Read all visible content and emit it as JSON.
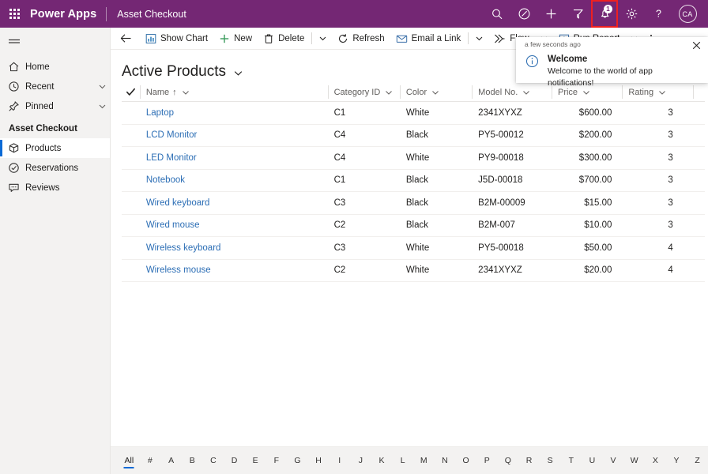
{
  "topbar": {
    "brand": "Power Apps",
    "app_name": "Asset Checkout",
    "waffle_name": "app-launcher",
    "actions": [
      {
        "name": "search-icon",
        "label": "Search"
      },
      {
        "name": "diagnostics-icon",
        "label": "Diagnostics"
      },
      {
        "name": "plus-icon",
        "label": "New"
      },
      {
        "name": "filter-icon",
        "label": "Filter"
      }
    ],
    "notification": {
      "name": "notification-bell-icon",
      "badge": "1",
      "highlight_color": "#ef2020"
    },
    "settings_label": "Settings",
    "help_label": "Help",
    "avatar_initials": "CA",
    "bar_color": "#742774"
  },
  "sidebar": {
    "hamburger_label": "Expand / collapse navigation",
    "items": [
      {
        "label": "Home",
        "icon": "home-icon",
        "chevron": false
      },
      {
        "label": "Recent",
        "icon": "clock-icon",
        "chevron": true
      },
      {
        "label": "Pinned",
        "icon": "pin-icon",
        "chevron": true
      }
    ],
    "group_label": "Asset Checkout",
    "entities": [
      {
        "label": "Products",
        "icon": "box-icon",
        "selected": true
      },
      {
        "label": "Reservations",
        "icon": "check-circle-icon",
        "selected": false
      },
      {
        "label": "Reviews",
        "icon": "comment-icon",
        "selected": false
      }
    ],
    "selected_accent": "#0b6ad6"
  },
  "commandbar": {
    "back_label": "Back",
    "buttons": [
      {
        "label": "Show Chart",
        "icon": "chart-icon"
      },
      {
        "label": "New",
        "icon": "plus-icon"
      },
      {
        "label": "Delete",
        "icon": "trash-icon"
      },
      {
        "label": "Refresh",
        "icon": "refresh-icon"
      },
      {
        "label": "Email a Link",
        "icon": "email-link-icon"
      },
      {
        "label": "Flow",
        "icon": "flow-icon"
      },
      {
        "label": "Run Report",
        "icon": "report-icon"
      }
    ],
    "overflow_label": "More commands"
  },
  "view": {
    "title": "Active Products",
    "chevron_name": "view-selector-chevron-icon"
  },
  "grid": {
    "select_all_name": "select-all-checkbox",
    "columns": [
      {
        "key": "name",
        "label": "Name",
        "sorted": true,
        "sort_glyph": "↑"
      },
      {
        "key": "category",
        "label": "Category ID",
        "sorted": false
      },
      {
        "key": "color",
        "label": "Color",
        "sorted": false
      },
      {
        "key": "model",
        "label": "Model No.",
        "sorted": false
      },
      {
        "key": "price",
        "label": "Price",
        "sorted": false
      },
      {
        "key": "rating",
        "label": "Rating",
        "sorted": false
      }
    ],
    "rows": [
      {
        "name": "Laptop",
        "category": "C1",
        "color": "White",
        "model": "2341XYXZ",
        "price": "$600.00",
        "rating": "3"
      },
      {
        "name": "LCD Monitor",
        "category": "C4",
        "color": "Black",
        "model": "PY5-00012",
        "price": "$200.00",
        "rating": "3"
      },
      {
        "name": "LED Monitor",
        "category": "C4",
        "color": "White",
        "model": "PY9-00018",
        "price": "$300.00",
        "rating": "3"
      },
      {
        "name": "Notebook",
        "category": "C1",
        "color": "Black",
        "model": "J5D-00018",
        "price": "$700.00",
        "rating": "3"
      },
      {
        "name": "Wired keyboard",
        "category": "C3",
        "color": "Black",
        "model": "B2M-00009",
        "price": "$15.00",
        "rating": "3"
      },
      {
        "name": "Wired mouse",
        "category": "C2",
        "color": "Black",
        "model": "B2M-007",
        "price": "$10.00",
        "rating": "3"
      },
      {
        "name": "Wireless keyboard",
        "category": "C3",
        "color": "White",
        "model": "PY5-00018",
        "price": "$50.00",
        "rating": "4"
      },
      {
        "name": "Wireless mouse",
        "category": "C2",
        "color": "White",
        "model": "2341XYXZ",
        "price": "$20.00",
        "rating": "4"
      }
    ],
    "link_color": "#2c6eb5"
  },
  "alphabet_bar": {
    "selected": "All",
    "items": [
      "All",
      "#",
      "A",
      "B",
      "C",
      "D",
      "E",
      "F",
      "G",
      "H",
      "I",
      "J",
      "K",
      "L",
      "M",
      "N",
      "O",
      "P",
      "Q",
      "R",
      "S",
      "T",
      "U",
      "V",
      "W",
      "X",
      "Y",
      "Z"
    ]
  },
  "notification_panel": {
    "time": "a few seconds ago",
    "close_name": "close-icon",
    "icon_name": "info-icon",
    "title": "Welcome",
    "message": "Welcome to the world of app notifications!"
  }
}
